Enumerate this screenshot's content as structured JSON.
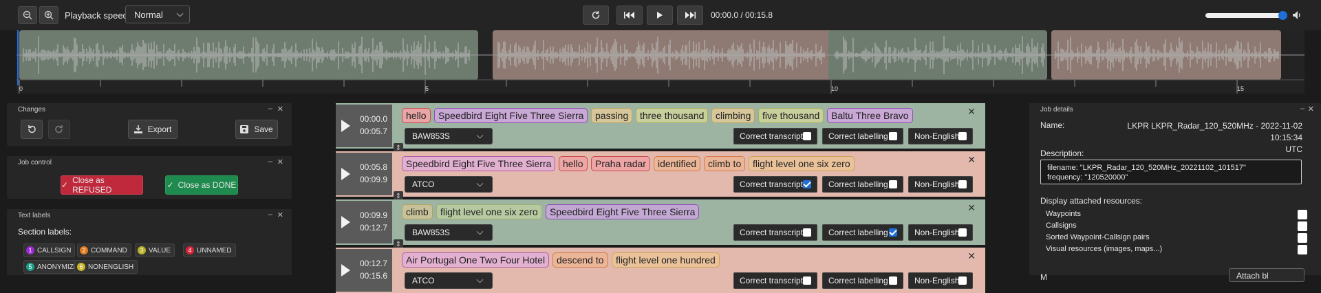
{
  "toolbar": {
    "playback_label": "Playback speed:",
    "speed": "Normal",
    "time": "00:00.0 / 00:15.8"
  },
  "timeline": {
    "ticks": [
      "0",
      "5",
      "10",
      "15"
    ]
  },
  "changes": {
    "title": "Changes",
    "export": "Export",
    "save": "Save"
  },
  "job_control": {
    "title": "Job control",
    "refused": "Close as REFUSED",
    "done": "Close as DONE"
  },
  "text_labels": {
    "title": "Text labels",
    "section": "Section labels:",
    "labels": [
      {
        "num": "1",
        "name": "CALLSIGN",
        "color": "#9b2bd1"
      },
      {
        "num": "2",
        "name": "COMMAND",
        "color": "#e07a1f"
      },
      {
        "num": "3",
        "name": "VALUE",
        "color": "#b7b12a"
      },
      {
        "num": "4",
        "name": "UNNAMED",
        "color": "#d8243a"
      },
      {
        "num": "5",
        "name": "ANONYMIZE",
        "color": "#1aa08a"
      },
      {
        "num": "6",
        "name": "NONENGLISH",
        "color": "#c8b52a"
      }
    ]
  },
  "segments": [
    {
      "start": "00:00.0",
      "end": "00:05.7",
      "speaker": "BAW853S",
      "bg": "#9db4a3",
      "chips": [
        {
          "text": "hello",
          "bg": "#e8a6a6",
          "border": "#c84a4a"
        },
        {
          "text": "Speedbird Eight Five Three Sierra",
          "bg": "#c9a8d6",
          "border": "#8d4fb5"
        },
        {
          "text": "passing",
          "bg": "#d6c69a",
          "border": "#b9a560"
        },
        {
          "text": "three thousand",
          "bg": "#c8cf9c",
          "border": "#a3b05a"
        },
        {
          "text": "climbing",
          "bg": "#d6c69a",
          "border": "#b9a560"
        },
        {
          "text": "five thousand",
          "bg": "#c8cf9c",
          "border": "#a3b05a"
        },
        {
          "text": "Baltu Three Bravo",
          "bg": "#c9a8d6",
          "border": "#8d4fb5"
        }
      ],
      "correct_transcript": false,
      "correct_labelling": false,
      "non_english": false
    },
    {
      "start": "00:05.8",
      "end": "00:09.9",
      "speaker": "ATCO",
      "bg": "#e4b9ad",
      "chips": [
        {
          "text": "Speedbird Eight Five Three Sierra",
          "bg": "#e2b0d0",
          "border": "#b45aa8"
        },
        {
          "text": "hello",
          "bg": "#eea5a5",
          "border": "#c84a4a"
        },
        {
          "text": "Praha radar",
          "bg": "#eea5a5",
          "border": "#c84a4a"
        },
        {
          "text": "identified",
          "bg": "#ebb597",
          "border": "#d37a4a"
        },
        {
          "text": "climb to",
          "bg": "#ebb597",
          "border": "#d37a4a"
        },
        {
          "text": "flight level one six zero",
          "bg": "#e9c29a",
          "border": "#cfa254"
        }
      ],
      "correct_transcript": true,
      "correct_labelling": false,
      "non_english": false
    },
    {
      "start": "00:09.9",
      "end": "00:12.7",
      "speaker": "BAW853S",
      "bg": "#9db4a3",
      "chips": [
        {
          "text": "climb",
          "bg": "#c8c29a",
          "border": "#b3a35a"
        },
        {
          "text": "flight level one six zero",
          "bg": "#b6c9a0",
          "border": "#a0b070"
        },
        {
          "text": "Speedbird Eight Five Three Sierra",
          "bg": "#c2a8d2",
          "border": "#8d4fb5"
        }
      ],
      "correct_transcript": false,
      "correct_labelling": true,
      "non_english": false
    },
    {
      "start": "00:12.7",
      "end": "00:15.6",
      "speaker": "ATCO",
      "bg": "#e4b9ad",
      "chips": [
        {
          "text": "Air Portugal One Two Four Hotel",
          "bg": "#e2b0d0",
          "border": "#b45aa8"
        },
        {
          "text": "descend to",
          "bg": "#ebb597",
          "border": "#d37a4a"
        },
        {
          "text": "flight level one hundred",
          "bg": "#e9c29a",
          "border": "#cfa254"
        }
      ],
      "correct_transcript": false,
      "correct_labelling": false,
      "non_english": false
    }
  ],
  "checkbox_labels": {
    "ct": "Correct transcript",
    "cl": "Correct labelling",
    "ne": "Non-English"
  },
  "job_details": {
    "title": "Job details",
    "name_label": "Name:",
    "name_value": "LKPR LKPR_Radar_120_520MHz - 2022-11-02 10:15:34",
    "name_value2": "UTC",
    "desc_label": "Description:",
    "desc_line1": "filename: \"LKPR_Radar_120_520MHz_20221102_101517\"",
    "desc_line2": "frequency: \"120520000\"",
    "resources_label": "Display attached resources:",
    "resources": [
      "Waypoints",
      "Callsigns",
      "Sorted Waypoint-Callsign pairs",
      "Visual resources (images, maps...)"
    ],
    "bottom_left": "M",
    "bottom_btn": "Attach bl"
  }
}
